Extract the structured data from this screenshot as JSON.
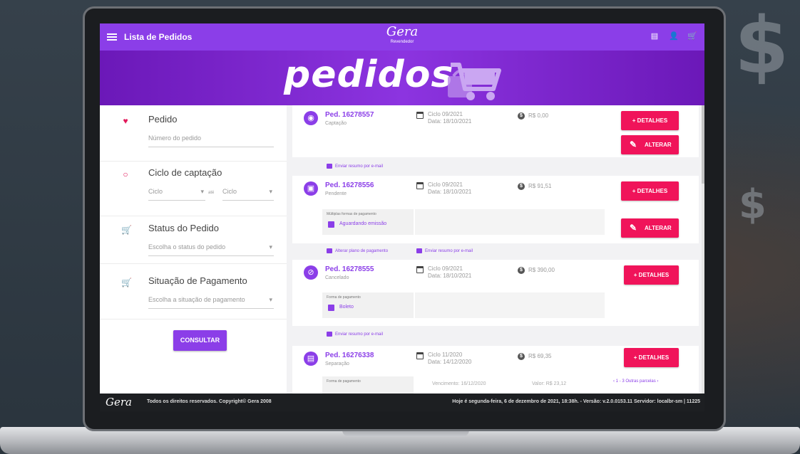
{
  "header": {
    "title": "Lista de Pedidos",
    "logo": "Gera",
    "logo_sub": "Revendedor",
    "icons": [
      "list-icon",
      "user-icon",
      "cart-icon"
    ]
  },
  "banner": {
    "text": "pedidos"
  },
  "filters": {
    "pedido_label": "Pedido",
    "pedido_placeholder": "Número do pedido",
    "ciclo_label": "Ciclo de captação",
    "ciclo_from": "Ciclo",
    "ciclo_ate": "até",
    "ciclo_to": "Ciclo",
    "status_label": "Status do Pedido",
    "status_placeholder": "Escolha o status do pedido",
    "pagamento_label": "Situação de Pagamento",
    "pagamento_placeholder": "Escolha a situação de pagamento",
    "consultar": "CONSULTAR"
  },
  "orders": [
    {
      "number": "Ped. 16278557",
      "status": "Captação",
      "ciclo": "Ciclo 09/2021",
      "data": "Data: 18/10/2021",
      "valor": "R$ 0,00",
      "detalhes": "+ DETALHES",
      "alterar": "ALTERAR",
      "link": "Enviar resumo por e-mail"
    },
    {
      "number": "Ped. 16278556",
      "status": "Pendente",
      "ciclo": "Ciclo 09/2021",
      "data": "Data: 18/10/2021",
      "valor": "R$ 91,51",
      "detalhes": "+ DETALHES",
      "alterar": "ALTERAR",
      "pay_title": "Múltiplas formas de pagamento",
      "pay_value": "Aguardando emissão",
      "link1": "Alterar plano de pagamento",
      "link2": "Enviar resumo por e-mail"
    },
    {
      "number": "Ped. 16278555",
      "status": "Cancelado",
      "ciclo": "Ciclo 09/2021",
      "data": "Data: 18/10/2021",
      "valor": "R$ 390,00",
      "detalhes": "+ DETALHES",
      "pay_title": "Forma de pagamento",
      "pay_value": "Boleto",
      "link": "Enviar resumo por e-mail"
    },
    {
      "number": "Ped. 16276338",
      "status": "Separação",
      "ciclo": "Ciclo 11/2020",
      "data": "Data: 14/12/2020",
      "valor": "R$ 69,35",
      "detalhes": "+ DETALHES",
      "pay_title": "Forma de pagamento",
      "vencimento": "Vencimento: 16/12/2020",
      "valor_parcela": "Valor: R$ 23,12",
      "parcelas": "‹ 1 - 3 Outras parcelas ›"
    }
  ],
  "footer": {
    "logo": "Gera",
    "copyright": "Todos os direitos reservados. Copyright© Gera 2008",
    "info": "Hoje é segunda-feira, 6 de dezembro de 2021, 18:38h. - Versão: v.2.0.0153.11 Servidor: localbr-sm | 11225"
  },
  "colors": {
    "primary": "#8b3ee8",
    "accent": "#f0145a",
    "banner": "#7a25cc"
  }
}
